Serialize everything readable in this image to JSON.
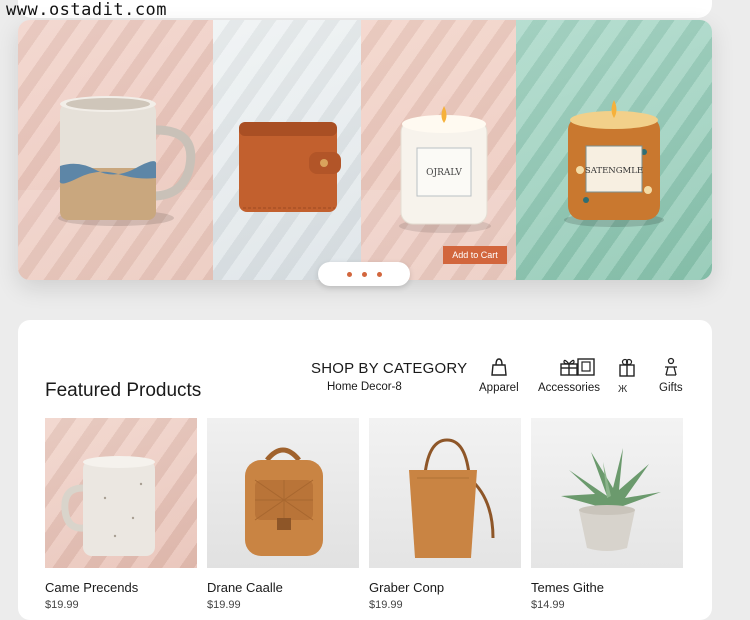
{
  "watermark": "www.ostadit.com",
  "hero": {
    "add_to_cart_label": "Add to Cart",
    "candle1_label": "OJRALV",
    "candle2_label": "SATENGMLE",
    "slide_count": 3
  },
  "shop": {
    "title": "SHOP BY CATEGORY",
    "home_decor": "Home Decor-8",
    "categories": [
      {
        "label": "Apparel",
        "icon": "bag-icon"
      },
      {
        "label": "Accessories",
        "icon": "gift-icon"
      },
      {
        "label": "",
        "icon": "frame-icon"
      },
      {
        "label": "",
        "icon": "giftbox-icon"
      },
      {
        "label": "Gifts",
        "icon": "figure-icon"
      }
    ],
    "misc_symbol": "Ж"
  },
  "featured": {
    "title": "Featured Products",
    "products": [
      {
        "name": "Came Precends",
        "price": "$19.99",
        "icon": "mug-icon"
      },
      {
        "name": "Drane Caalle",
        "price": "$19.99",
        "icon": "backpack-icon"
      },
      {
        "name": "Graber Conp",
        "price": "$19.99",
        "icon": "tote-bag-icon"
      },
      {
        "name": "Temes Githe",
        "price": "$14.99",
        "icon": "succulent-icon"
      }
    ]
  },
  "colors": {
    "accent": "#d2663d",
    "panel_pink": "#f1d1c8",
    "panel_mint": "#a9d8c8",
    "card_bg": "#ffffff"
  }
}
